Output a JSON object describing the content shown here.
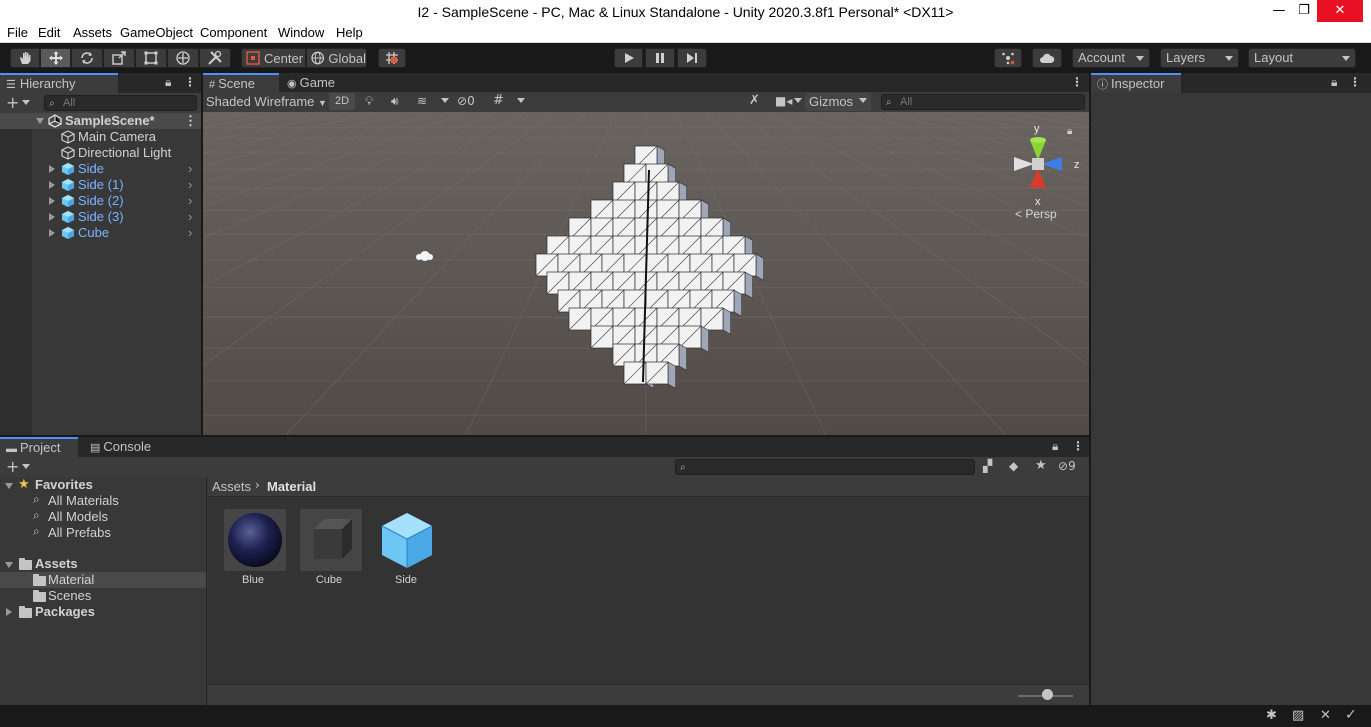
{
  "window": {
    "title": "I2 - SampleScene - PC, Mac & Linux Standalone - Unity 2020.3.8f1 Personal* <DX11>",
    "minimize": "—",
    "maximize": "❐",
    "close": "✕"
  },
  "menu": [
    "File",
    "Edit",
    "Assets",
    "GameObject",
    "Component",
    "Window",
    "Help"
  ],
  "toolbar": {
    "pivot_mode": "Center",
    "pivot_space": "Global",
    "account": "Account",
    "layers": "Layers",
    "layout": "Layout"
  },
  "hierarchy": {
    "tab": "Hierarchy",
    "search_placeholder": "All",
    "scene": "SampleScene*",
    "items": [
      {
        "label": "Main Camera",
        "icon": "gameobject-icon",
        "prefab": false
      },
      {
        "label": "Directional Light",
        "icon": "gameobject-icon",
        "prefab": false
      },
      {
        "label": "Side",
        "icon": "prefab-icon",
        "prefab": true
      },
      {
        "label": "Side (1)",
        "icon": "prefab-icon",
        "prefab": true
      },
      {
        "label": "Side (2)",
        "icon": "prefab-icon",
        "prefab": true
      },
      {
        "label": "Side (3)",
        "icon": "prefab-icon",
        "prefab": true
      },
      {
        "label": "Cube",
        "icon": "prefab-icon",
        "prefab": true
      }
    ]
  },
  "scene": {
    "tabs": [
      "Scene",
      "Game"
    ],
    "draw_mode": "Shaded Wireframe",
    "mode_2d": "2D",
    "hidden_count": "0",
    "gizmos": "Gizmos",
    "search_placeholder": "All",
    "gizmo_labels": {
      "y": "y",
      "z": "z",
      "x": "x",
      "projection": "Persp"
    }
  },
  "inspector": {
    "tab": "Inspector"
  },
  "project": {
    "tabs": [
      "Project",
      "Console"
    ],
    "hidden_count": "9",
    "favorites": {
      "label": "Favorites",
      "items": [
        "All Materials",
        "All Models",
        "All Prefabs"
      ]
    },
    "assets": {
      "label": "Assets",
      "items": [
        "Material",
        "Scenes"
      ]
    },
    "packages": "Packages",
    "breadcrumb": [
      "Assets",
      "Material"
    ],
    "grid": [
      {
        "name": "Blue",
        "kind": "material-sphere",
        "color": "#1a1e44"
      },
      {
        "name": "Cube",
        "kind": "material-cube",
        "color": "#4a4a4a"
      },
      {
        "name": "Side",
        "kind": "prefab",
        "color": "#6ec6f5"
      }
    ],
    "icon_zoom": 0.5
  },
  "colors": {
    "accent": "#4d90fe",
    "prefab_text": "#7cb4ff",
    "panel": "#383838",
    "dark_bg": "#191919"
  }
}
